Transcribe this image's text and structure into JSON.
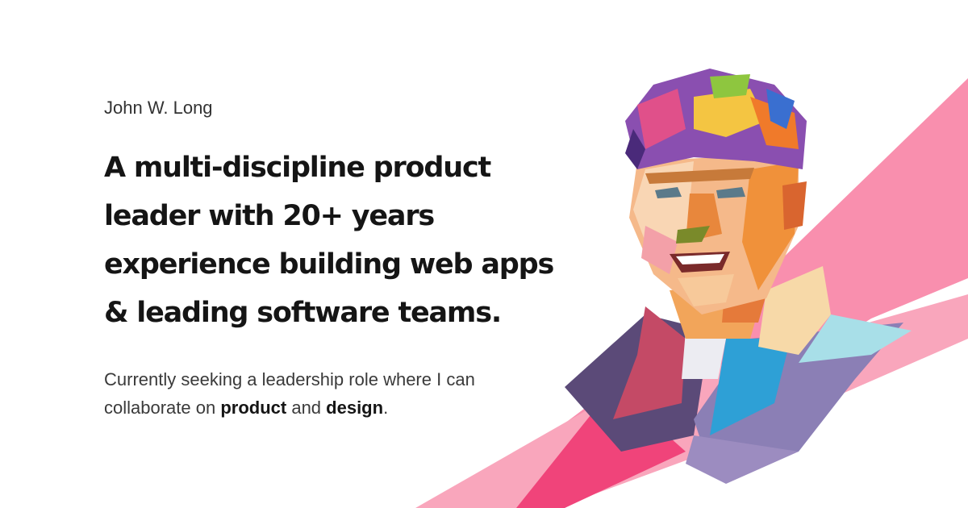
{
  "profile": {
    "name": "John W. Long",
    "headline_lines": [
      "A multi-discipline product",
      "leader with 20+ years",
      "experience building web apps",
      "& leading software teams."
    ],
    "tagline": {
      "prefix": "Currently seeking a leadership role where I can",
      "line2_start": "collaborate on ",
      "emphasis_1": "product",
      "joiner": " and ",
      "emphasis_2": "design",
      "suffix": "."
    }
  },
  "colors": {
    "background": "#ffffff",
    "ribbon_pink": "#f7a2b8",
    "ribbon_hot_pink": "#f0447a",
    "heading": "#151515"
  }
}
